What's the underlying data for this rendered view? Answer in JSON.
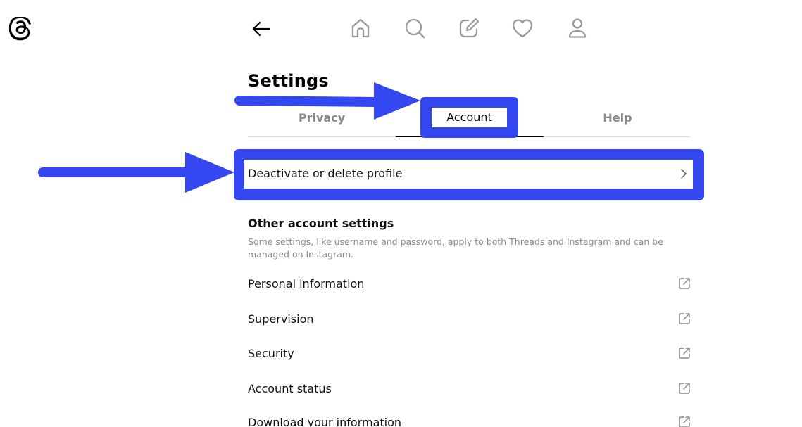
{
  "app": {
    "logo_icon": "threads-logo-icon"
  },
  "topnav": {
    "back_icon": "arrow-left-icon",
    "icons": [
      "home-icon",
      "search-icon",
      "compose-icon",
      "heart-icon",
      "profile-icon"
    ]
  },
  "title": "Settings",
  "tabs": [
    {
      "label": "Privacy",
      "active": false
    },
    {
      "label": "Account",
      "active": true
    },
    {
      "label": "Help",
      "active": false
    }
  ],
  "deactivate_row": {
    "label": "Deactivate or delete profile",
    "icon": "chevron-right-icon"
  },
  "other_settings": {
    "title": "Other account settings",
    "description": "Some settings, like username and password, apply to both Threads and Instagram and can be managed on Instagram.",
    "items": [
      {
        "label": "Personal information",
        "icon": "external-link-icon"
      },
      {
        "label": "Supervision",
        "icon": "external-link-icon"
      },
      {
        "label": "Security",
        "icon": "external-link-icon"
      },
      {
        "label": "Account status",
        "icon": "external-link-icon"
      },
      {
        "label": "Download your information",
        "icon": "external-link-icon"
      }
    ]
  },
  "annotations": {
    "highlight_color": "#3447f0"
  }
}
